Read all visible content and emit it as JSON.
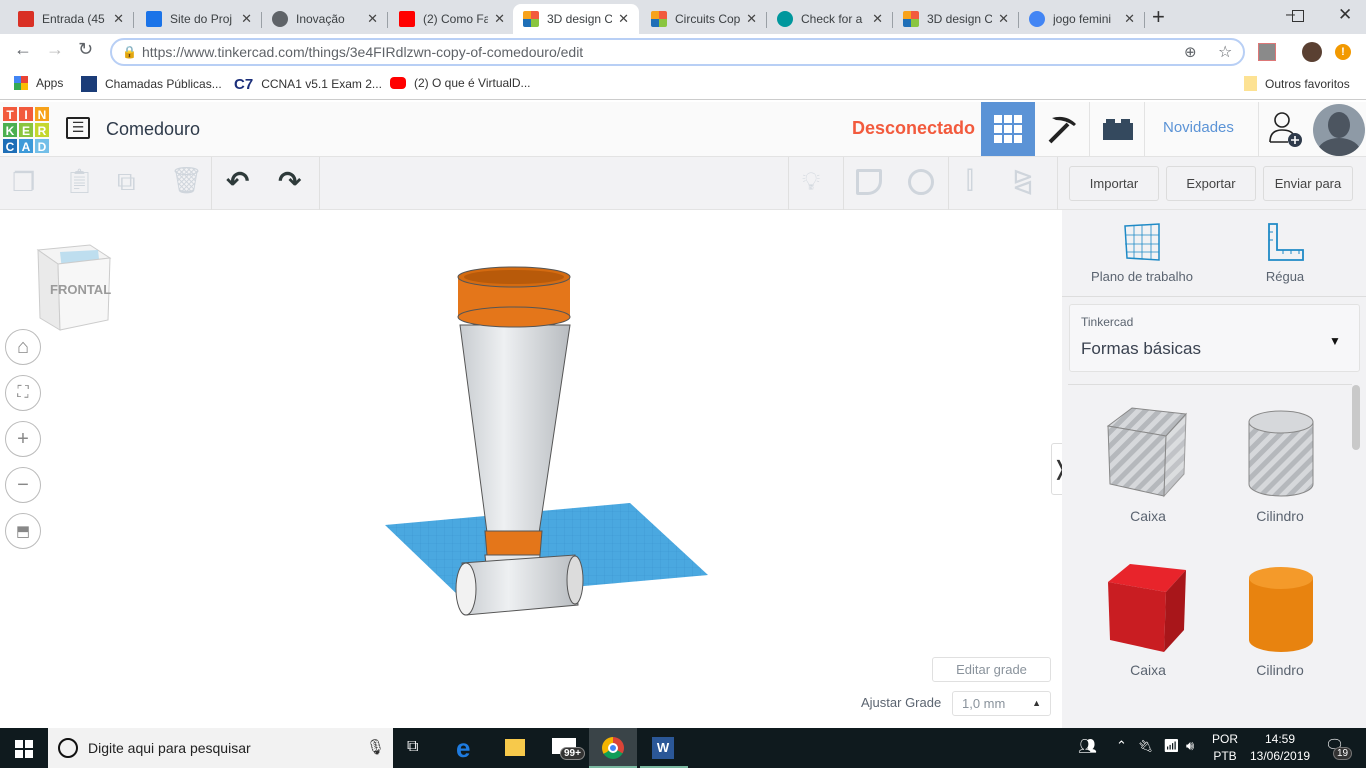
{
  "browser": {
    "tabs": [
      {
        "label": "Entrada (45",
        "icon": "gmail-icon",
        "color": "#d93025"
      },
      {
        "label": "Site do Proj",
        "icon": "google-sites-icon",
        "color": "#1a73e8"
      },
      {
        "label": "Inovação",
        "icon": "globe-icon",
        "color": "#5f6368"
      },
      {
        "label": "(2) Como Fa",
        "icon": "youtube-icon",
        "color": "#ff0000"
      },
      {
        "label": "3D design C",
        "icon": "tinkercad-icon",
        "color": "#e44"
      },
      {
        "label": "Circuits Cop",
        "icon": "tinkercad-icon",
        "color": "#e44"
      },
      {
        "label": "Check for a",
        "icon": "arduino-icon",
        "color": "#00979d"
      },
      {
        "label": "3D design C",
        "icon": "tinkercad-icon",
        "color": "#e44"
      },
      {
        "label": "jogo femini",
        "icon": "google-icon",
        "color": "#4285f4"
      }
    ],
    "active_tab": 4,
    "url": "https://www.tinkercad.com/things/3e4FIRdlzwn-copy-of-comedouro/edit",
    "bookmarks": [
      {
        "label": "Apps"
      },
      {
        "label": "Chamadas Públicas..."
      },
      {
        "label": "CCNA1 v5.1 Exam 2..."
      },
      {
        "label": "(2) O que é VirtualD..."
      }
    ],
    "other_bookmarks": "Outros favoritos"
  },
  "app": {
    "logo_letters": [
      "T",
      "I",
      "N",
      "K",
      "E",
      "R",
      "C",
      "A",
      "D"
    ],
    "title": "Comedouro",
    "status": "Desconectado",
    "status_color": "#f25a3d",
    "accent": "#5b93d6",
    "news": "Novidades"
  },
  "toolbar": {
    "import": "Importar",
    "export": "Exportar",
    "send": "Enviar para"
  },
  "viewcube": {
    "label": "FRONTAL"
  },
  "panel": {
    "workplane": "Plano de trabalho",
    "ruler": "Régua",
    "library_source": "Tinkercad",
    "library": "Formas básicas",
    "shapes": [
      {
        "label": "Caixa",
        "style": "hole",
        "color": "#c7c9cc"
      },
      {
        "label": "Cilindro",
        "style": "hole",
        "color": "#c7c9cc"
      },
      {
        "label": "Caixa",
        "style": "solid",
        "color": "#d41e24"
      },
      {
        "label": "Cilindro",
        "style": "solid",
        "color": "#f08a17"
      }
    ]
  },
  "grid": {
    "edit": "Editar grade",
    "snap_label": "Ajustar Grade",
    "snap_value": "1,0 mm"
  },
  "taskbar": {
    "search": "Digite aqui para pesquisar",
    "mail_badge": "99+",
    "lang1": "POR",
    "lang2": "PTB",
    "time": "14:59",
    "date": "13/06/2019",
    "notifications": "19"
  }
}
